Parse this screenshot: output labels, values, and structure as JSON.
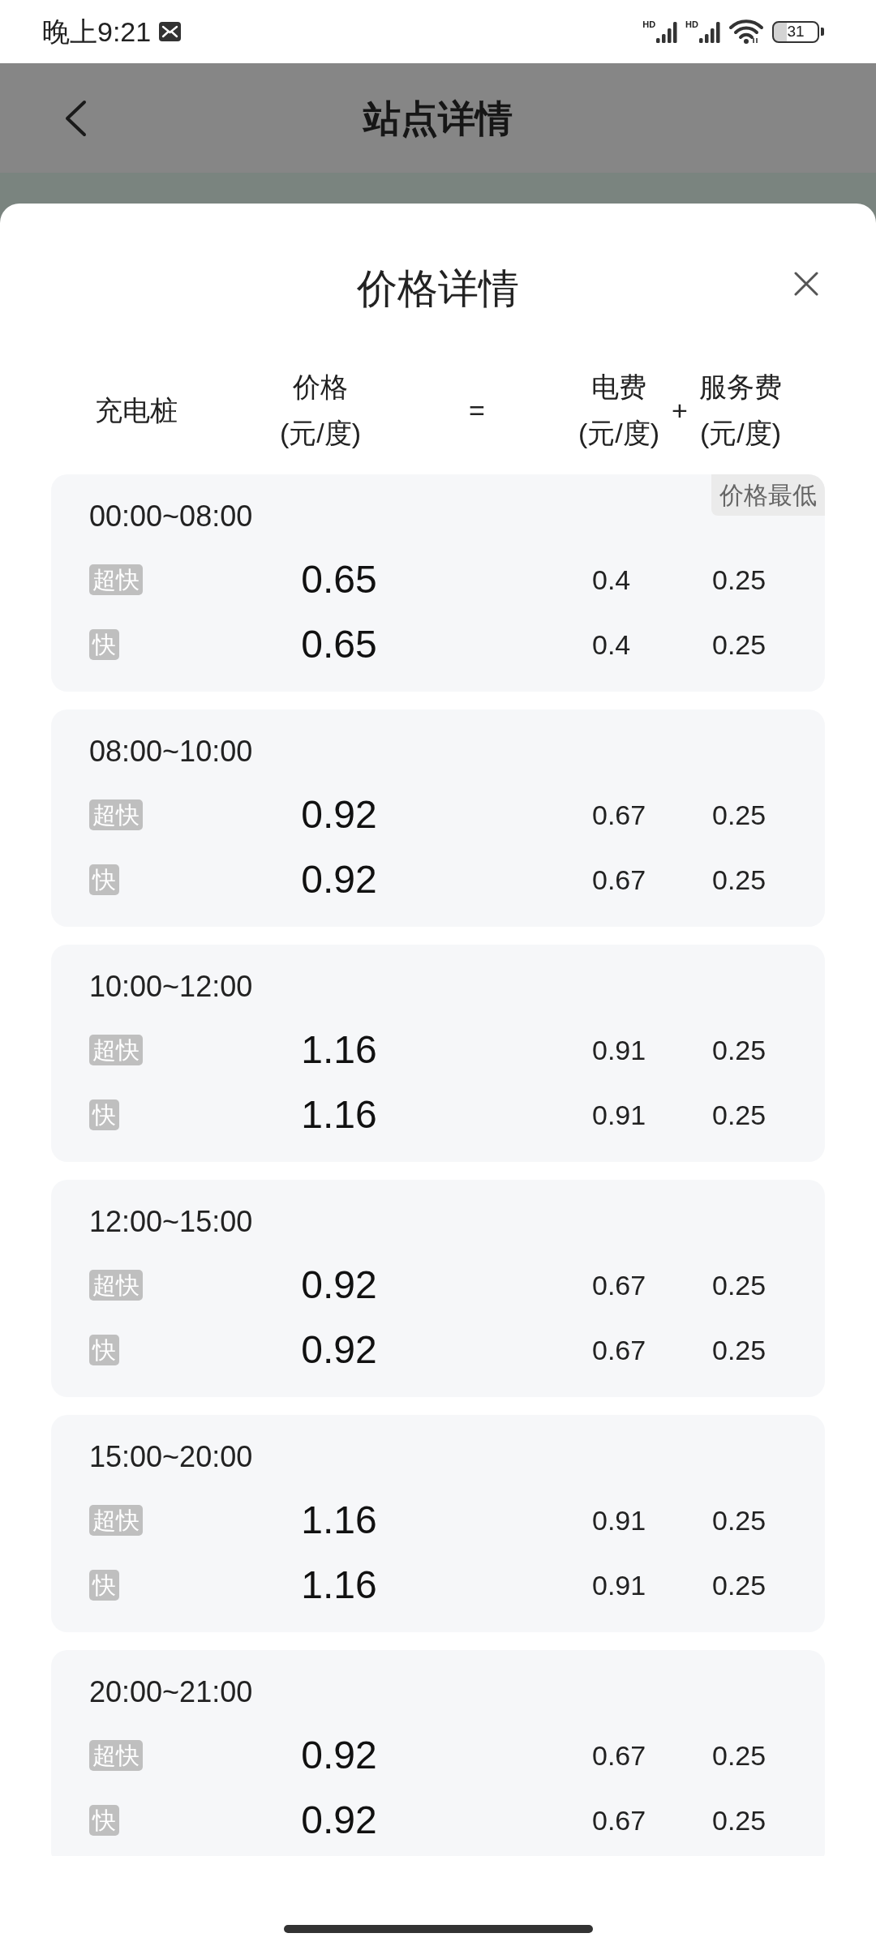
{
  "status_bar": {
    "time": "晚上9:21",
    "signals": [
      {
        "network": "HD"
      },
      {
        "network": "HD"
      }
    ],
    "battery": "31"
  },
  "top_bar": {
    "title": "站点详情"
  },
  "price_sheet": {
    "title": "价格详情",
    "columns": [
      {
        "kind": "heading",
        "label": "充电桩"
      },
      {
        "kind": "heading",
        "label": "价格",
        "unit": "(元/度)"
      },
      {
        "kind": "operator",
        "label": "="
      },
      {
        "kind": "heading",
        "label": "电费",
        "unit": "(元/度)"
      },
      {
        "kind": "operator",
        "label": "+"
      },
      {
        "kind": "heading",
        "label": "服务费",
        "unit": "(元/度)"
      }
    ],
    "periods": [
      {
        "time": "00:00~08:00",
        "tag": "价格最低",
        "rows": [
          {
            "charger": "超快",
            "price": "0.65",
            "electricity_fee": "0.4",
            "service_fee": "0.25"
          },
          {
            "charger": "快",
            "price": "0.65",
            "electricity_fee": "0.4",
            "service_fee": "0.25"
          }
        ]
      },
      {
        "time": "08:00~10:00",
        "rows": [
          {
            "charger": "超快",
            "price": "0.92",
            "electricity_fee": "0.67",
            "service_fee": "0.25"
          },
          {
            "charger": "快",
            "price": "0.92",
            "electricity_fee": "0.67",
            "service_fee": "0.25"
          }
        ]
      },
      {
        "time": "10:00~12:00",
        "rows": [
          {
            "charger": "超快",
            "price": "1.16",
            "electricity_fee": "0.91",
            "service_fee": "0.25"
          },
          {
            "charger": "快",
            "price": "1.16",
            "electricity_fee": "0.91",
            "service_fee": "0.25"
          }
        ]
      },
      {
        "time": "12:00~15:00",
        "rows": [
          {
            "charger": "超快",
            "price": "0.92",
            "electricity_fee": "0.67",
            "service_fee": "0.25"
          },
          {
            "charger": "快",
            "price": "0.92",
            "electricity_fee": "0.67",
            "service_fee": "0.25"
          }
        ]
      },
      {
        "time": "15:00~20:00",
        "rows": [
          {
            "charger": "超快",
            "price": "1.16",
            "electricity_fee": "0.91",
            "service_fee": "0.25"
          },
          {
            "charger": "快",
            "price": "1.16",
            "electricity_fee": "0.91",
            "service_fee": "0.25"
          }
        ]
      },
      {
        "time": "20:00~21:00",
        "rows": [
          {
            "charger": "超快",
            "price": "0.92",
            "electricity_fee": "0.67",
            "service_fee": "0.25"
          },
          {
            "charger": "快",
            "price": "0.92",
            "electricity_fee": "0.67",
            "service_fee": "0.25"
          }
        ]
      }
    ]
  }
}
